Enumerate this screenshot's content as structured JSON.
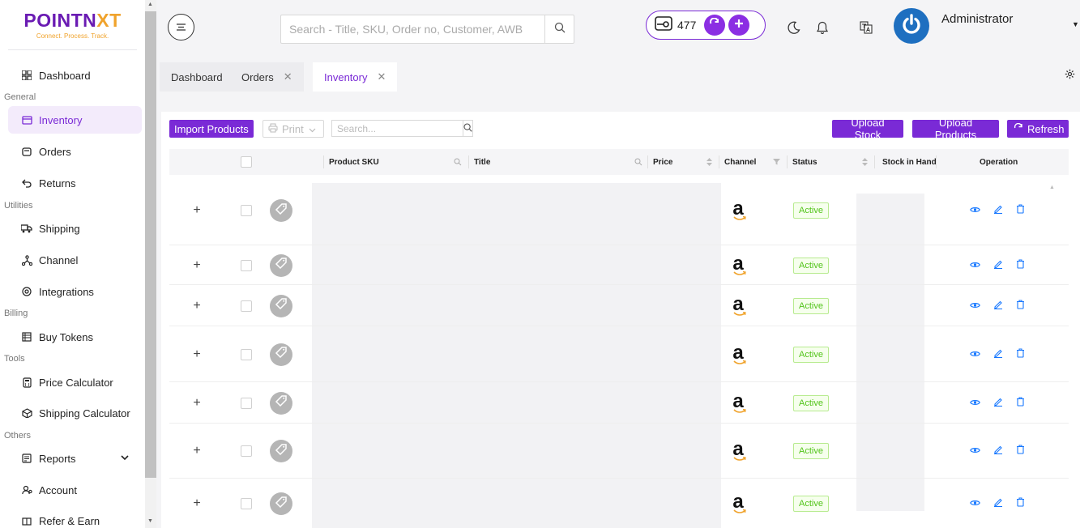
{
  "brand": {
    "name_main": "POINTN",
    "name_accent": "XT",
    "tagline": "Connect. Process. Track."
  },
  "sidebar": {
    "items": [
      {
        "label": "Dashboard",
        "icon": "dashboard-icon"
      },
      {
        "section": "General"
      },
      {
        "label": "Inventory",
        "icon": "inventory-icon",
        "active": true
      },
      {
        "label": "Orders",
        "icon": "orders-icon"
      },
      {
        "label": "Returns",
        "icon": "returns-icon"
      },
      {
        "section": "Utilities"
      },
      {
        "label": "Shipping",
        "icon": "truck-icon"
      },
      {
        "label": "Channel",
        "icon": "channel-icon"
      },
      {
        "label": "Integrations",
        "icon": "integrations-icon"
      },
      {
        "section": "Billing"
      },
      {
        "label": "Buy Tokens",
        "icon": "tokens-icon"
      },
      {
        "section": "Tools"
      },
      {
        "label": "Price Calculator",
        "icon": "calculator-icon"
      },
      {
        "label": "Shipping Calculator",
        "icon": "shipping-calc-icon"
      },
      {
        "section": "Others"
      },
      {
        "label": "Reports",
        "icon": "reports-icon",
        "chevron": "chevron-down-icon"
      },
      {
        "label": "Account",
        "icon": "account-icon"
      },
      {
        "label": "Refer & Earn",
        "icon": "refer-icon"
      }
    ]
  },
  "header": {
    "search_placeholder": "Search - Title, SKU, Order no, Customer, AWB",
    "wallet_balance": "477",
    "user_name": "Administrator"
  },
  "tabs": [
    {
      "label": "Dashboard",
      "closable": false,
      "active": false
    },
    {
      "label": "Orders",
      "closable": true,
      "active": false
    },
    {
      "label": "Inventory",
      "closable": true,
      "active": true
    }
  ],
  "toolbar": {
    "import_label": "Import Products",
    "print_label": "Print",
    "search_placeholder": "Search...",
    "upload_stock_label": "Upload Stock",
    "upload_products_label": "Upload Products",
    "refresh_label": "Refresh"
  },
  "table": {
    "columns": [
      "Product SKU",
      "Title",
      "Price",
      "Channel",
      "Status",
      "Stock in Hand",
      "Operation"
    ],
    "rows": [
      {
        "channel": "amazon",
        "status": "Active"
      },
      {
        "channel": "amazon",
        "status": "Active"
      },
      {
        "channel": "amazon",
        "status": "Active"
      },
      {
        "channel": "amazon",
        "status": "Active"
      },
      {
        "channel": "amazon",
        "status": "Active"
      },
      {
        "channel": "amazon",
        "status": "Active"
      },
      {
        "channel": "amazon",
        "status": "Active"
      }
    ],
    "expand_symbol": "+",
    "channel_letter": "a"
  },
  "colors": {
    "accent": "#7a2ad6",
    "status_active": "#52c41a",
    "op_icons": "#1677ff",
    "avatar": "#1e6fc0"
  }
}
